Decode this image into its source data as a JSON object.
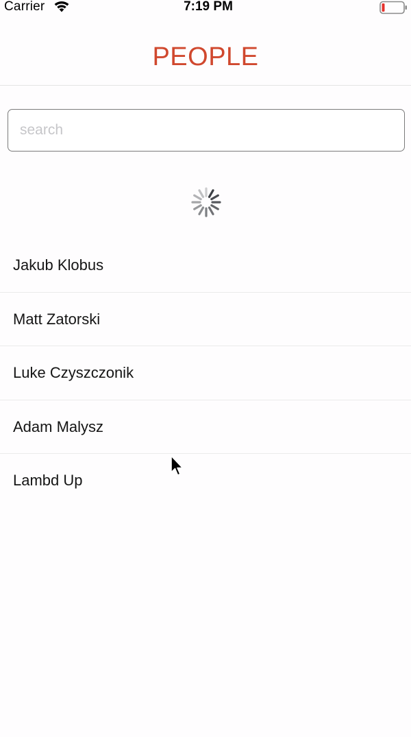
{
  "status_bar": {
    "carrier": "Carrier",
    "time": "7:19 PM",
    "icons": [
      "wifi-icon",
      "battery-icon"
    ],
    "battery_color": "#e5322d"
  },
  "header": {
    "title": "PEOPLE",
    "title_color": "#d0482e"
  },
  "search": {
    "placeholder": "search",
    "value": ""
  },
  "loading": {
    "icon": "spinner-icon"
  },
  "people": [
    {
      "name": "Jakub Klobus"
    },
    {
      "name": "Matt Zatorski"
    },
    {
      "name": "Luke Czyszczonik"
    },
    {
      "name": "Adam Malysz"
    },
    {
      "name": "Lambd Up"
    }
  ]
}
